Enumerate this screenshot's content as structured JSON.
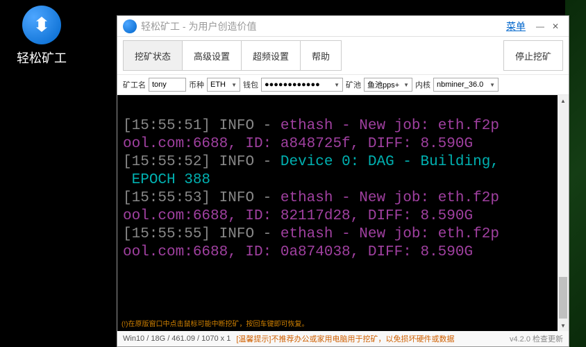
{
  "desktop": {
    "icon_label": "轻松矿工"
  },
  "titlebar": {
    "title": "轻松矿工 - 为用户创造价值",
    "menu": "菜单"
  },
  "toolbar": {
    "tab_status": "挖矿状态",
    "tab_advanced": "高级设置",
    "tab_overclock": "超频设置",
    "tab_help": "帮助",
    "stop": "停止挖矿"
  },
  "config": {
    "miner_label": "矿工名",
    "miner_value": "tony",
    "coin_label": "币种",
    "coin_value": "ETH",
    "wallet_label": "钱包",
    "wallet_value": "●●●●●●●●●●●●",
    "pool_label": "矿池",
    "pool_value": "鱼池pps+",
    "kernel_label": "内核",
    "kernel_value": "nbminer_36.0"
  },
  "console": {
    "lines": [
      {
        "ts": "[15:55:51]",
        "lvl": " INFO - ",
        "tag": "ethash",
        "txt": " - New job: eth.f2p",
        "cont": "ool.com:6688, ID: a848725f, DIFF: 8.590G"
      },
      {
        "ts": "[15:55:52]",
        "lvl": " INFO - ",
        "tag": "Device 0: DAG - Building,",
        "cont": " EPOCH 388",
        "dev": true
      },
      {
        "ts": "[15:55:53]",
        "lvl": " INFO - ",
        "tag": "ethash",
        "txt": " - New job: eth.f2p",
        "cont": "ool.com:6688, ID: 82117d28, DIFF: 8.590G"
      },
      {
        "ts": "[15:55:55]",
        "lvl": " INFO - ",
        "tag": "ethash",
        "txt": " - New job: eth.f2p",
        "cont": "ool.com:6688, ID: 0a874038, DIFF: 8.590G"
      }
    ],
    "footer": "(!)在原版窗口中点击鼠标可能中断挖矿，按回车键即可恢复。"
  },
  "status": {
    "sys": "Win10 / 18G / 461.09 / 1070 x 1",
    "warning": "[温馨提示]不推荐办公或家用电脑用于挖矿，以免损坏硬件或数据",
    "version": "v4.2.0 检查更新"
  }
}
